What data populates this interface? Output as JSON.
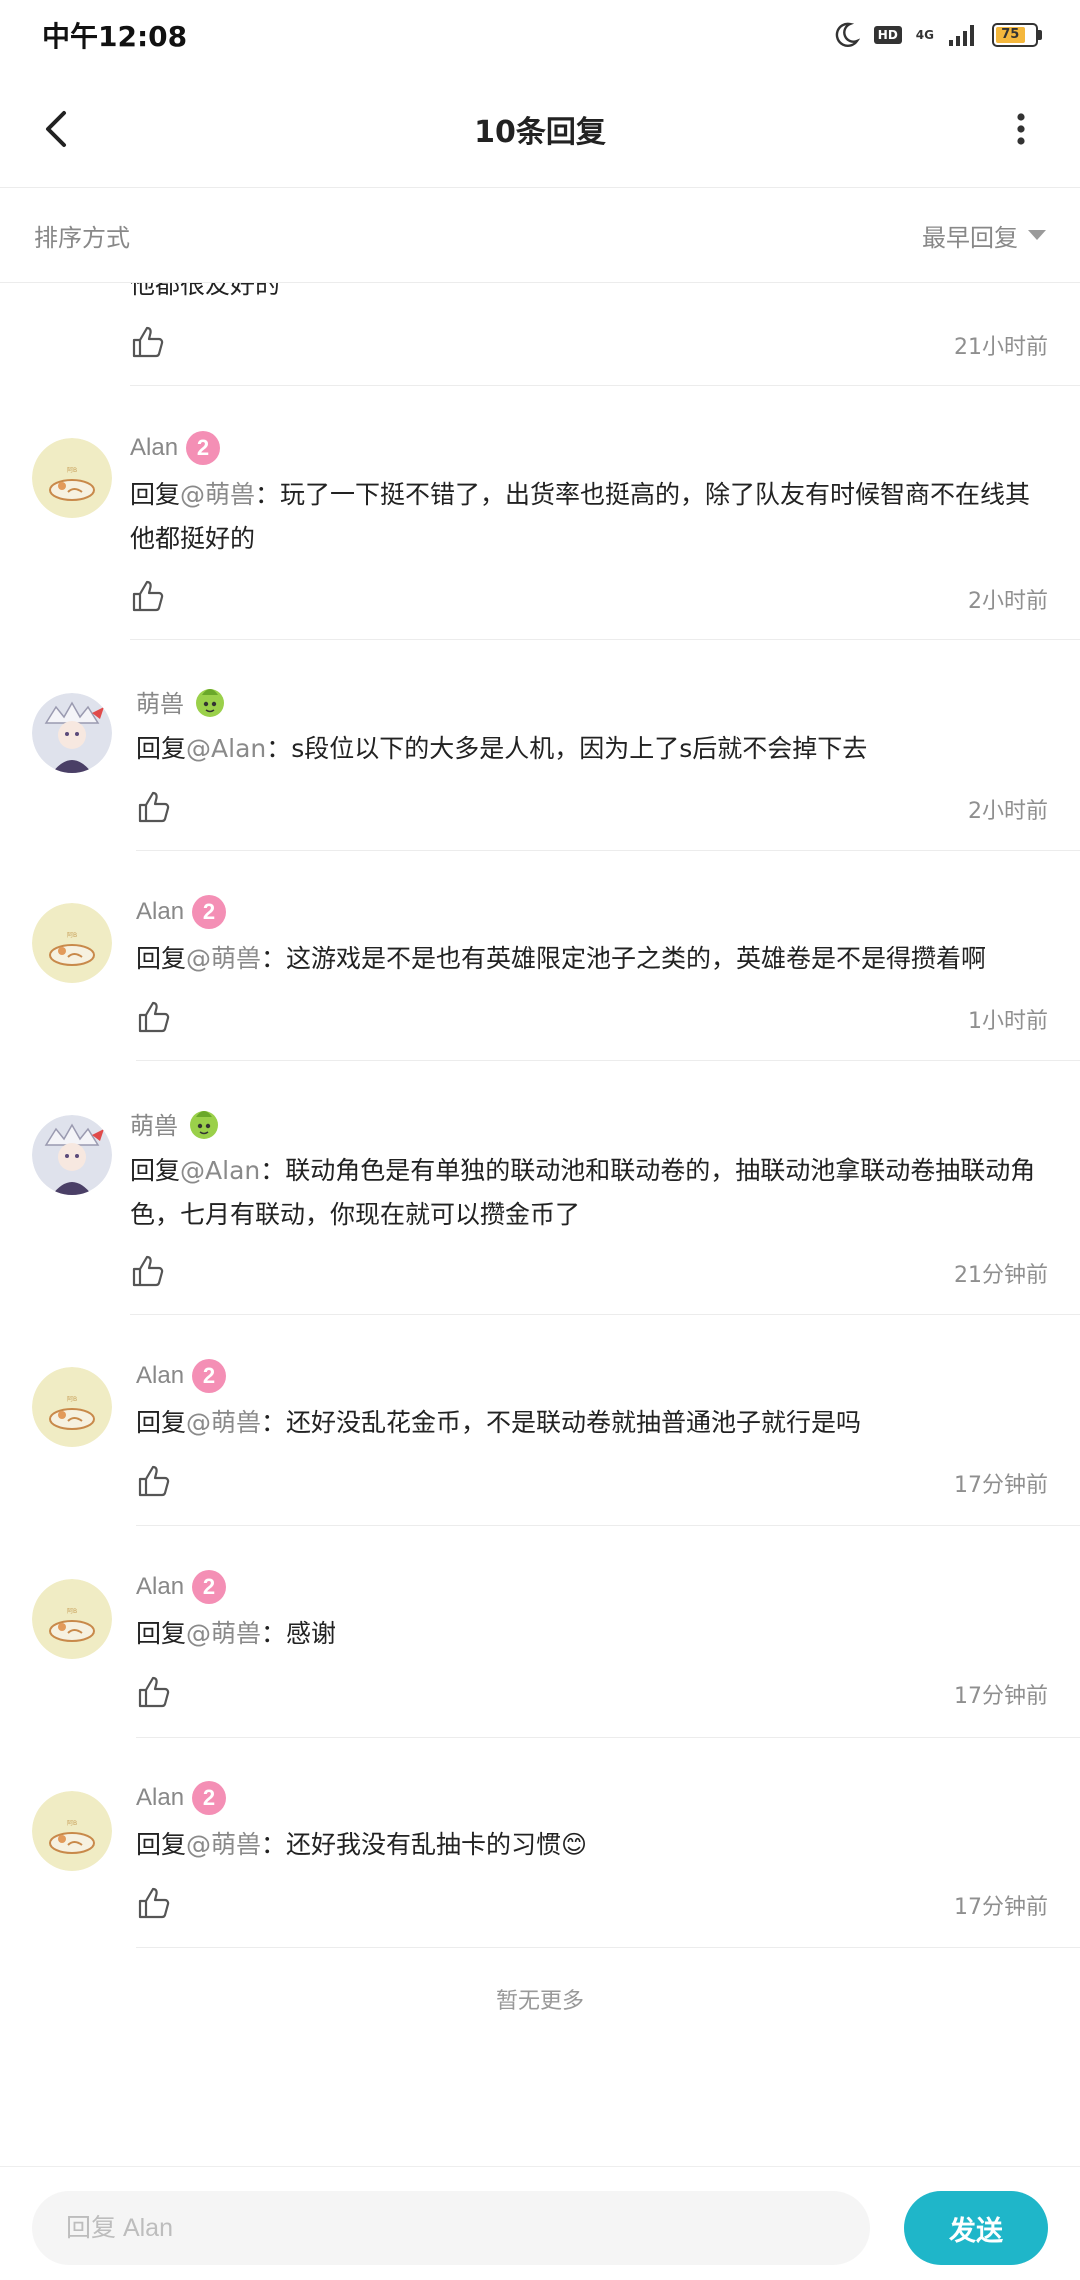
{
  "status_bar": {
    "time": "中午12:08",
    "hd": "HD",
    "network": "4G",
    "battery": "75"
  },
  "header": {
    "title": "10条回复"
  },
  "sort": {
    "label": "排序方式",
    "value": "最早回复"
  },
  "partial": {
    "text": "他都很友好的",
    "time": "21小时前"
  },
  "replies": [
    {
      "user": "Alan",
      "level": "2",
      "prefix": "回复",
      "mention": "@萌兽",
      "text": "：玩了一下挺不错了，出货率也挺高的，除了队友有时候智商不在线其他都挺好的",
      "time": "2小时前"
    },
    {
      "user": "萌兽",
      "prefix": "回复",
      "mention": "@Alan",
      "text": "：s段位以下的大多是人机，因为上了s后就不会掉下去",
      "time": "2小时前"
    },
    {
      "user": "Alan",
      "level": "2",
      "prefix": "回复",
      "mention": "@萌兽",
      "text": "：这游戏是不是也有英雄限定池子之类的，英雄卷是不是得攒着啊",
      "time": "1小时前"
    },
    {
      "user": "萌兽",
      "prefix": "回复",
      "mention": "@Alan",
      "text": "：联动角色是有单独的联动池和联动卷的，抽联动池拿联动卷抽联动角色，七月有联动，你现在就可以攒金币了",
      "time": "21分钟前"
    },
    {
      "user": "Alan",
      "level": "2",
      "prefix": "回复",
      "mention": "@萌兽",
      "text": "：还好没乱花金币，不是联动卷就抽普通池子就行是吗",
      "time": "17分钟前"
    },
    {
      "user": "Alan",
      "level": "2",
      "prefix": "回复",
      "mention": "@萌兽",
      "text": "：感谢",
      "time": "17分钟前"
    },
    {
      "user": "Alan",
      "level": "2",
      "prefix": "回复",
      "mention": "@萌兽",
      "text": "：还好我没有乱抽卡的习惯😊",
      "time": "17分钟前"
    }
  ],
  "footer": {
    "no_more": "暂无更多"
  },
  "input": {
    "placeholder": "回复 Alan",
    "send": "发送"
  },
  "colors": {
    "accent": "#1fb6c9",
    "level_badge": "#f48fb5"
  }
}
